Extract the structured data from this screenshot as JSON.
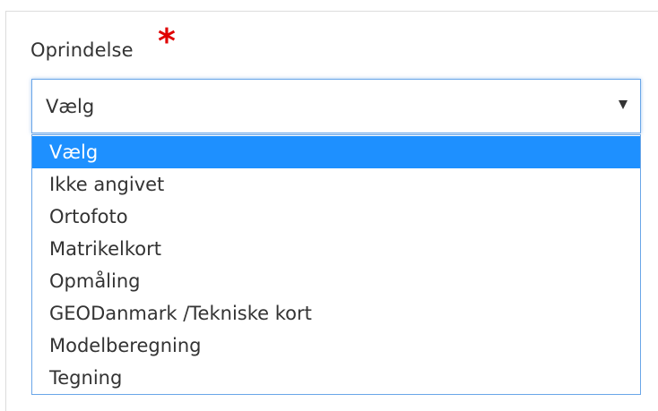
{
  "field": {
    "label": "Oprindelse",
    "required_marker": "*"
  },
  "select": {
    "current_value": "Vælg",
    "caret_icon": "caret-down-icon"
  },
  "dropdown": {
    "highlighted_index": 0,
    "options": [
      {
        "label": "Vælg"
      },
      {
        "label": "Ikke angivet"
      },
      {
        "label": "Ortofoto"
      },
      {
        "label": "Matrikelkort"
      },
      {
        "label": "Opmåling"
      },
      {
        "label": "GEODanmark /Tekniske kort"
      },
      {
        "label": "Modelberegning"
      },
      {
        "label": "Tegning"
      }
    ]
  },
  "colors": {
    "accent": "#1e90ff",
    "required": "#e00000",
    "focus_border": "#6aa6e8"
  }
}
